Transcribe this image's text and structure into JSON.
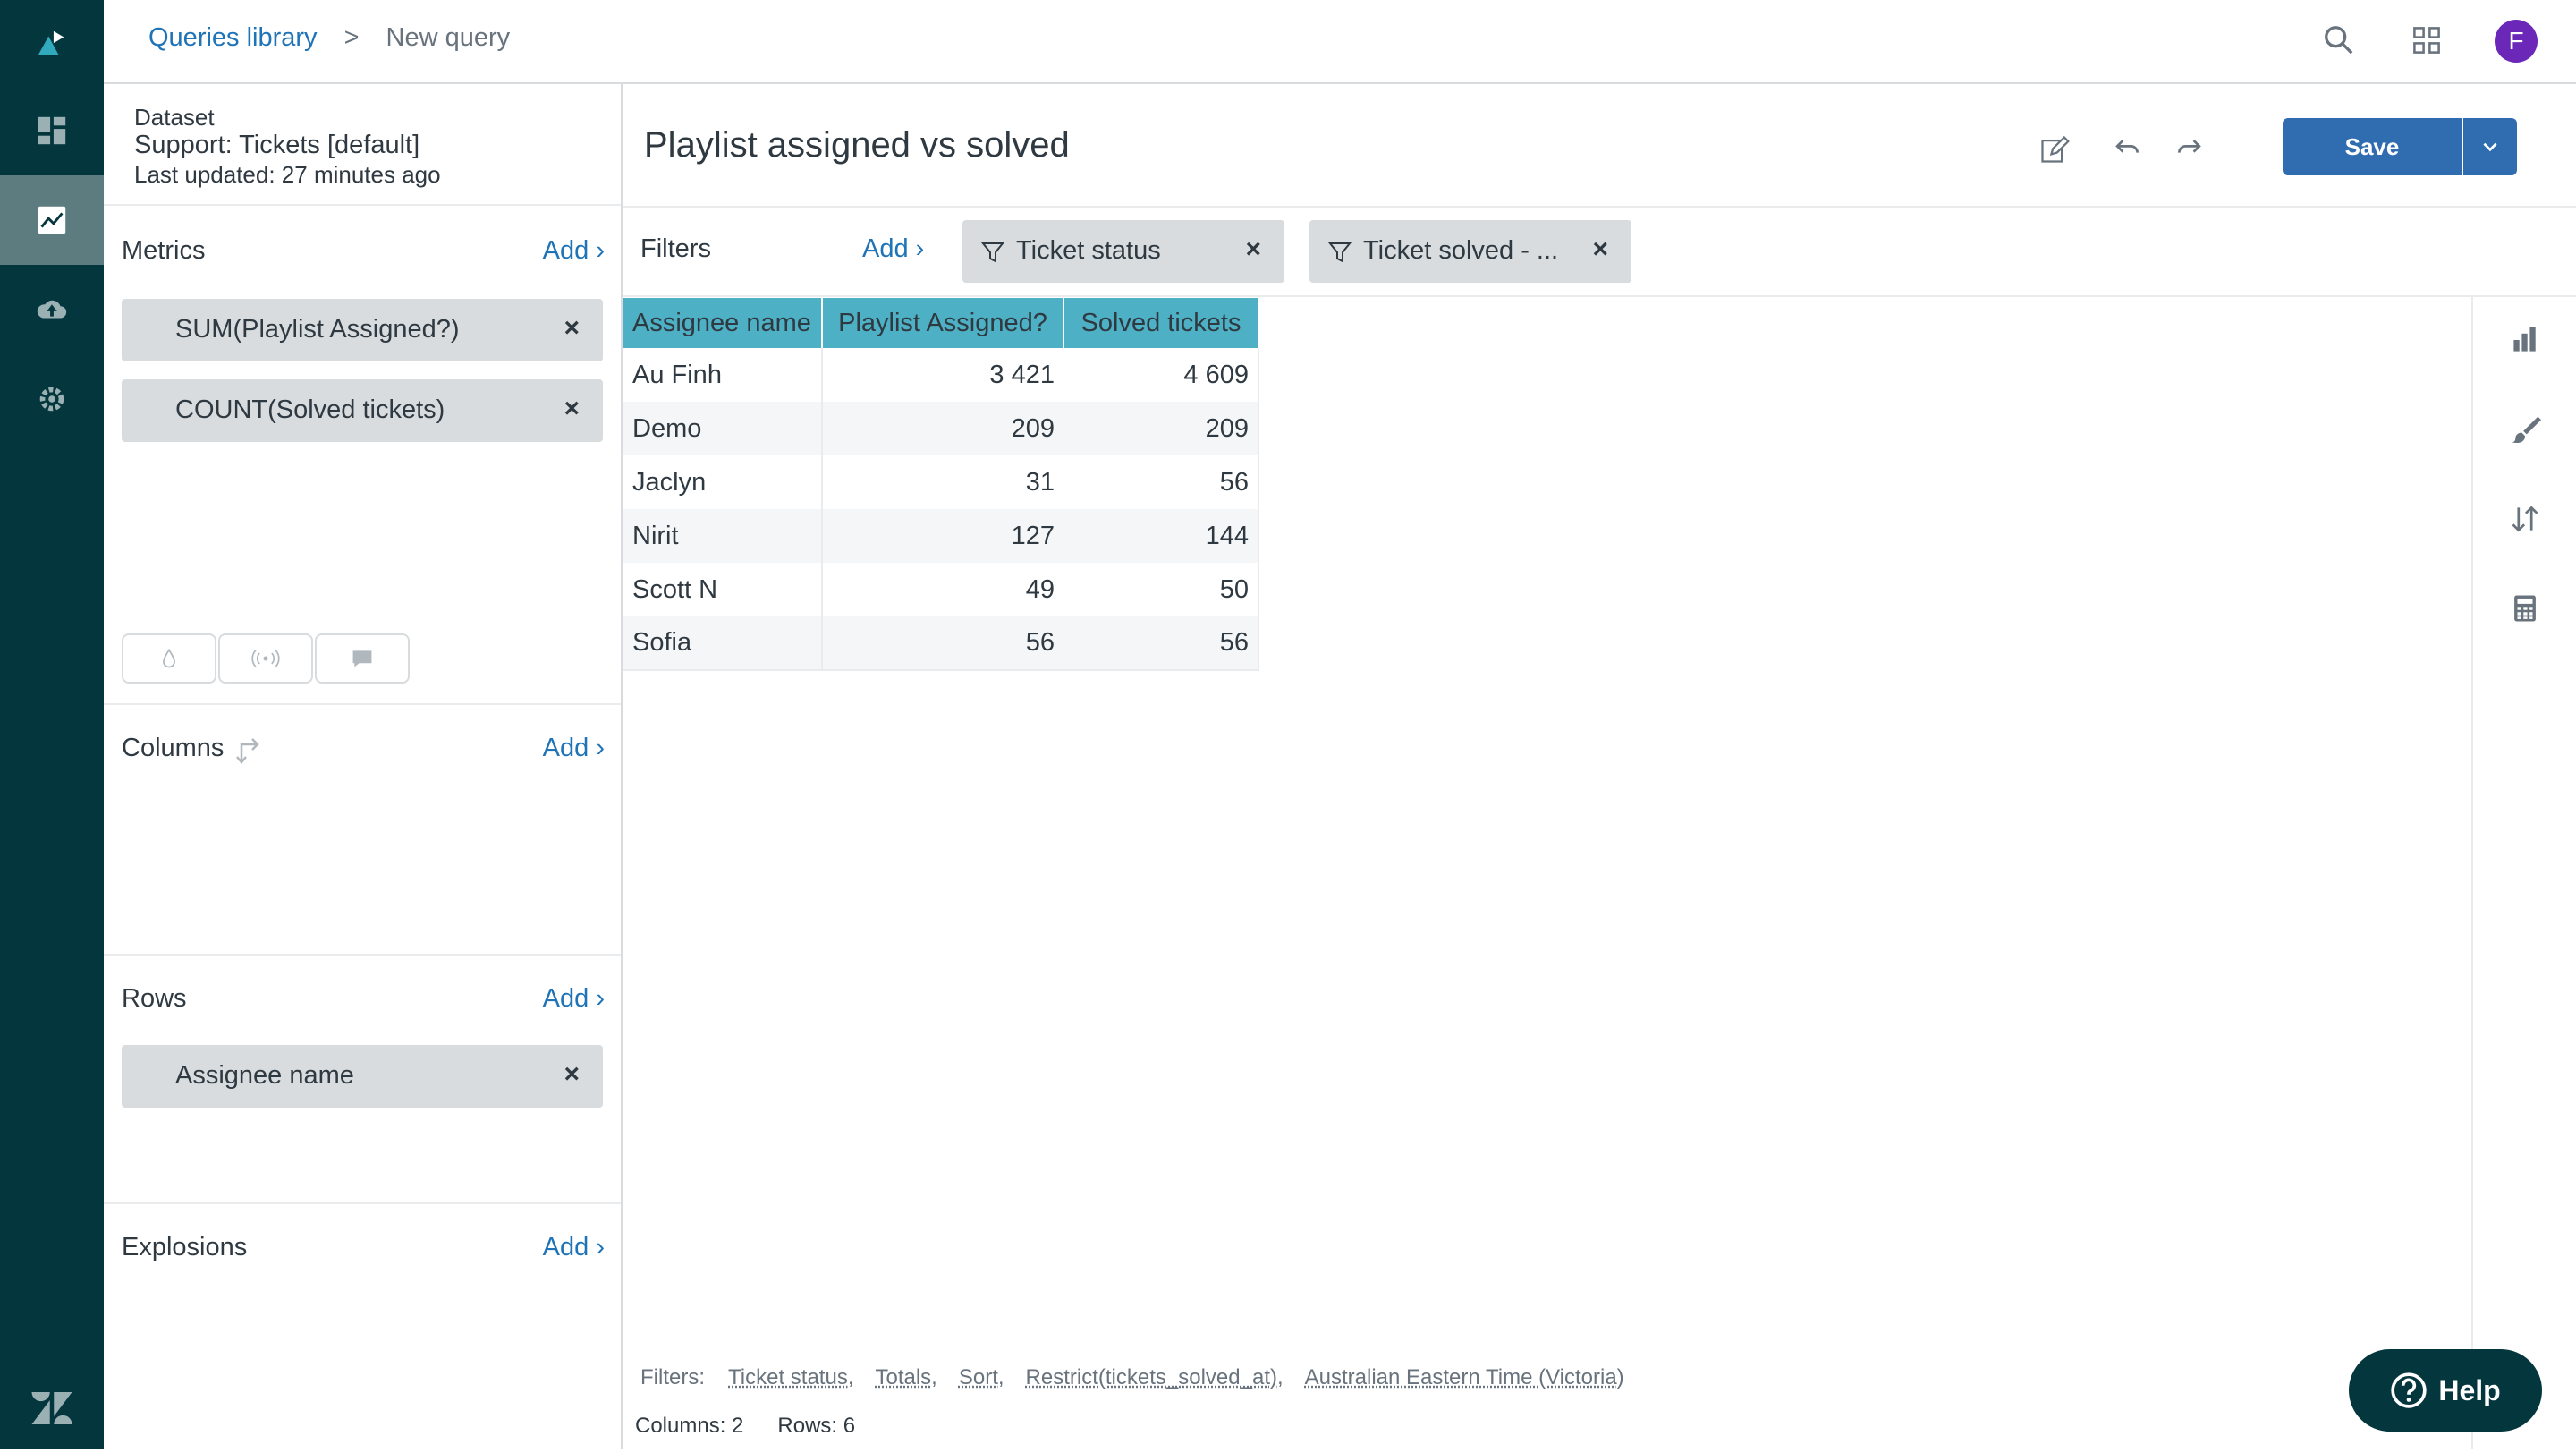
{
  "breadcrumb": {
    "parent": "Queries library",
    "separator": ">",
    "current": "New query"
  },
  "user": {
    "initial": "F"
  },
  "dataset": {
    "label": "Dataset",
    "name": "Support: Tickets [default]",
    "updated": "Last updated: 27 minutes ago"
  },
  "metrics": {
    "title": "Metrics",
    "add": "Add ›",
    "items": [
      "SUM(Playlist Assigned?)",
      "COUNT(Solved tickets)"
    ]
  },
  "columns": {
    "title": "Columns",
    "add": "Add ›"
  },
  "rows": {
    "title": "Rows",
    "add": "Add ›",
    "items": [
      "Assignee name"
    ]
  },
  "explosions": {
    "title": "Explosions",
    "add": "Add ›"
  },
  "query": {
    "title": "Playlist assigned vs solved",
    "save": "Save"
  },
  "filters": {
    "title": "Filters",
    "add": "Add ›",
    "chips": [
      "Ticket status",
      "Ticket solved - ..."
    ]
  },
  "table": {
    "headers": [
      "Assignee name",
      "Playlist Assigned?",
      "Solved tickets"
    ],
    "rows": [
      [
        "Au Finh",
        "3 421",
        "4 609"
      ],
      [
        "Demo",
        "209",
        "209"
      ],
      [
        "Jaclyn",
        "31",
        "56"
      ],
      [
        "Nirit",
        "127",
        "144"
      ],
      [
        "Scott N",
        "49",
        "50"
      ],
      [
        "Sofia",
        "56",
        "56"
      ]
    ]
  },
  "footer": {
    "filters_label": "Filters:",
    "filter_items": [
      "Ticket status,",
      "Totals,",
      "Sort,",
      "Restrict(tickets_solved_at),",
      "Australian Eastern Time (Victoria)"
    ],
    "columns_count": "Columns: 2",
    "rows_count": "Rows: 6"
  },
  "help": {
    "label": "Help"
  },
  "colors": {
    "nav_bg": "#03363d",
    "accent": "#1f73b7",
    "header_teal": "#4db0c4",
    "save_blue": "#2f6db0"
  }
}
